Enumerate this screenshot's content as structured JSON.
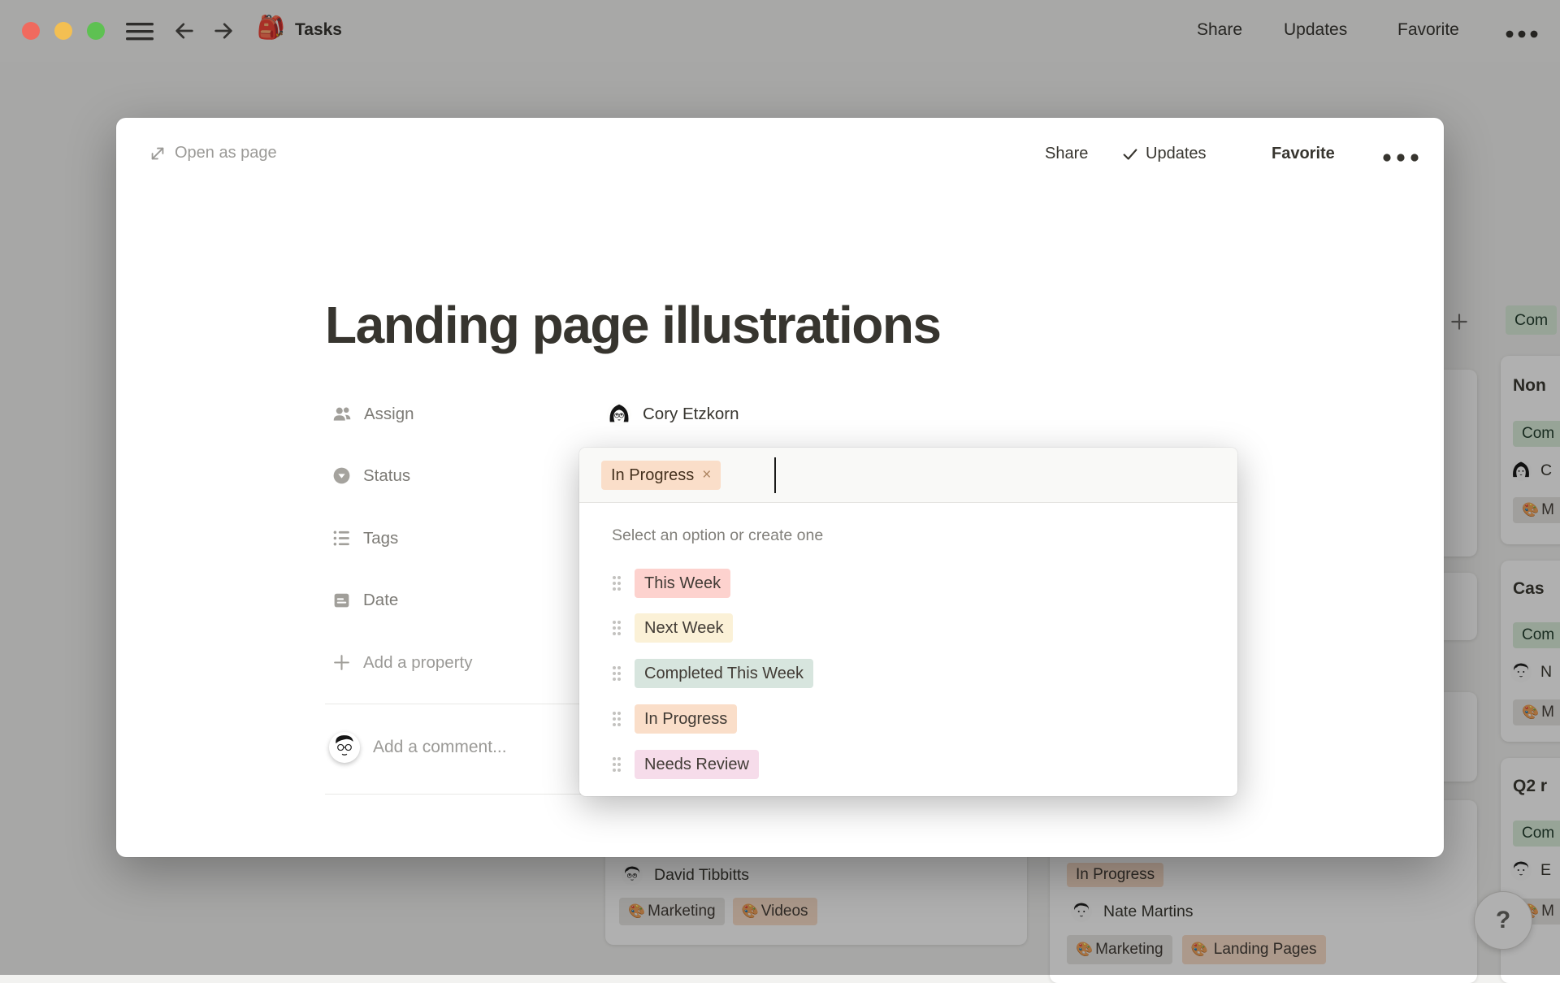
{
  "icons": {
    "backpack": "🎒",
    "palette": "🎨"
  },
  "colors": {
    "traffic_red": "#f06a5e",
    "traffic_yellow": "#f3bf52",
    "traffic_green": "#5ec152",
    "tag_orange": "#fadec9",
    "tag_red": "#fdd2ce",
    "tag_yellow": "#fbf1d7",
    "tag_green_light": "#d7e5de",
    "tag_pink": "#f6dcea",
    "tag_gray": "#e7e6e3",
    "tag_green": "#dbeddb",
    "dark_text": "#37352f"
  },
  "window": {
    "title": "Tasks",
    "actions": {
      "share": "Share",
      "updates": "Updates",
      "favorite": "Favorite"
    }
  },
  "modal": {
    "open_as_page": "Open as page",
    "actions": {
      "share": "Share",
      "updates": "Updates",
      "favorite": "Favorite"
    },
    "title": "Landing page illustrations",
    "properties": [
      {
        "label": "Assign",
        "value": "Cory Etzkorn"
      },
      {
        "label": "Status"
      },
      {
        "label": "Tags"
      },
      {
        "label": "Date"
      }
    ],
    "add_property": "Add a property",
    "add_comment_placeholder": "Add a comment..."
  },
  "dropdown": {
    "selected": {
      "label": "In Progress",
      "color": "#fadec9",
      "remove": "×"
    },
    "hint": "Select an option or create one",
    "options": [
      {
        "label": "This Week",
        "color": "#fdd2ce"
      },
      {
        "label": "Next Week",
        "color": "#fbf1d7"
      },
      {
        "label": "Completed This Week",
        "color": "#d7e5de"
      },
      {
        "label": "In Progress",
        "color": "#fadec9"
      },
      {
        "label": "Needs Review",
        "color": "#f6dcea"
      }
    ]
  },
  "board": {
    "column_header": {
      "label": "Com",
      "color": "#dbeddb"
    },
    "right_cards": [
      {
        "title": "Non",
        "status": "Com",
        "assignee": "C",
        "tag": "M"
      },
      {
        "title": "Cas",
        "status": "Com",
        "assignee": "N",
        "tag": "M"
      },
      {
        "title": "Q2 r",
        "status": "Com",
        "assignee": "E",
        "tag": "M"
      }
    ],
    "card_david": {
      "assignee": "David Tibbitts",
      "tags": [
        {
          "label": "Marketing",
          "color": "#e7e6e3"
        },
        {
          "label": "Videos",
          "color": "#fadec9"
        }
      ]
    },
    "card_nate": {
      "status": {
        "label": "In Progress",
        "color": "#fadec9"
      },
      "assignee": "Nate Martins",
      "tags": [
        {
          "label": "Marketing",
          "color": "#e7e6e3"
        },
        {
          "label": "Landing Pages",
          "color": "#fadec9"
        }
      ]
    },
    "help_label": "?"
  }
}
